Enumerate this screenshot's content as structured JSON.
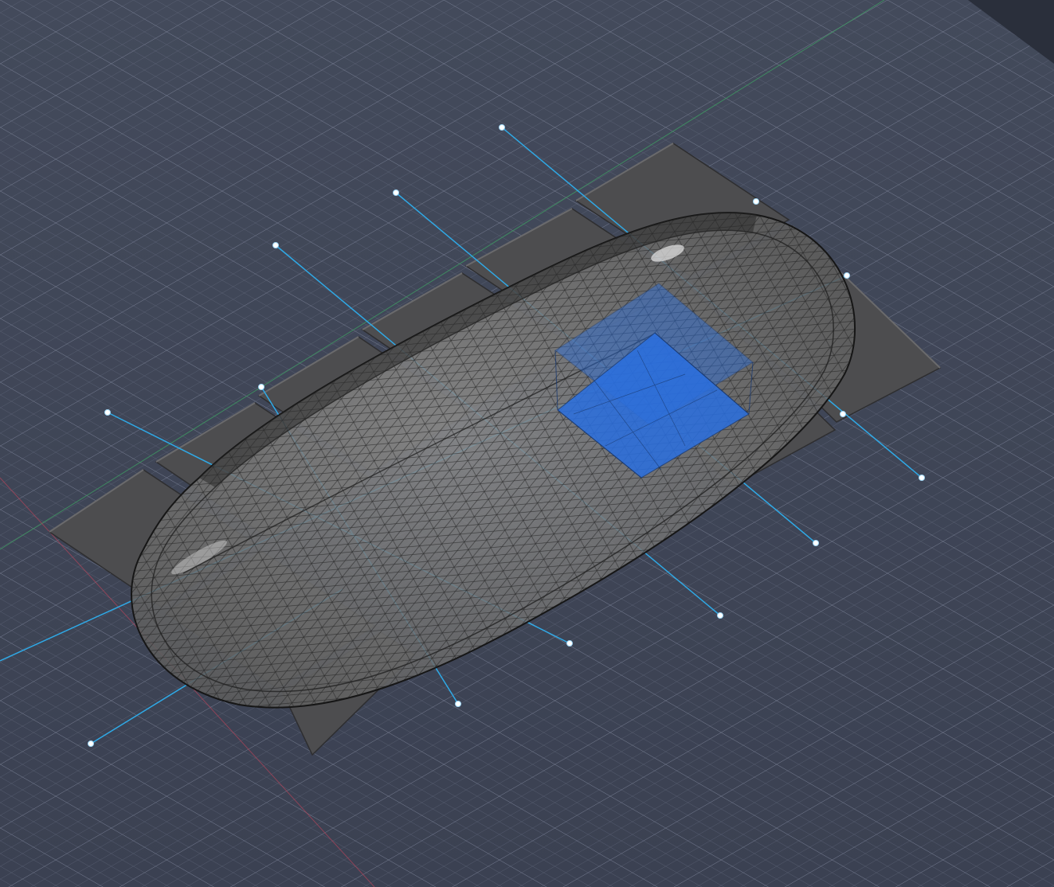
{
  "viewport": {
    "background": "#3e4455",
    "grid_color": "#6b7286",
    "grid_major_color": "#848ba0",
    "x_axis_color": "#b0445a",
    "y_axis_color": "#3f9a63",
    "guide_line_color": "#2fa9e6",
    "grip_color": "#ffffff"
  },
  "model": {
    "tray_tile_color": "#4d4d4f",
    "shell_color": "#7a7a7a",
    "mesh_line_color": "#1a1a1a",
    "selected_box_color": "#2a6fe0",
    "tray_tile_count": 10,
    "selected_object": "box"
  },
  "corner_panel": {
    "color": "#2a2f3b"
  }
}
